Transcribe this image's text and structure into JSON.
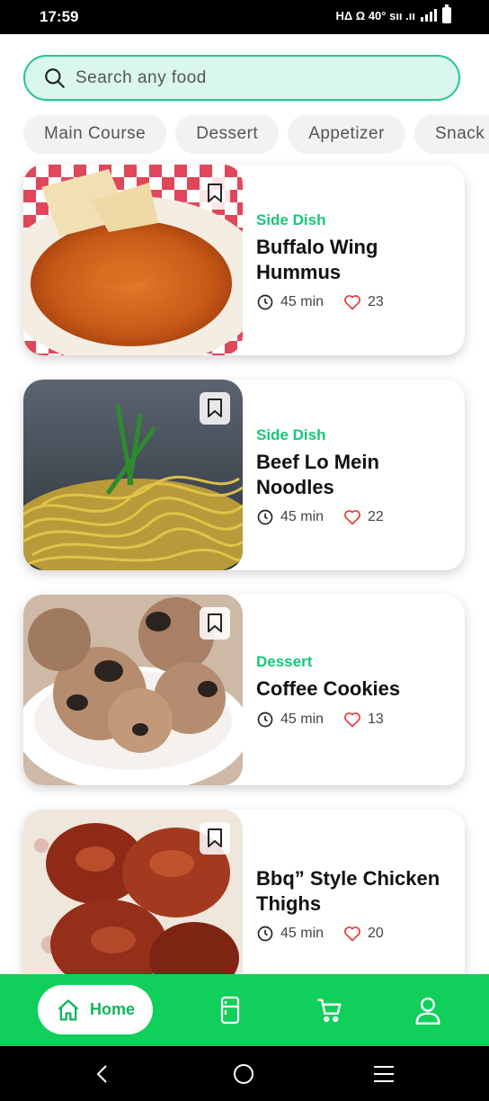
{
  "status_bar": {
    "time": "17:59",
    "indicators": "ΗΔ Ω 40° ѕıı .ıı"
  },
  "search": {
    "placeholder": "Search any food",
    "icon": "search-icon"
  },
  "categories": [
    "Main Course",
    "Dessert",
    "Appetizer",
    "Snack"
  ],
  "recipes": [
    {
      "category": "Side Dish",
      "title": "Buffalo Wing Hummus",
      "time": "45 min",
      "likes": "23"
    },
    {
      "category": "Side Dish",
      "title": "Beef Lo Mein Noodles",
      "time": "45 min",
      "likes": "22"
    },
    {
      "category": "Dessert",
      "title": "Coffee Cookies",
      "time": "45 min",
      "likes": "13"
    },
    {
      "category": "",
      "title": "Bbq” Style Chicken Thighs",
      "time": "45 min",
      "likes": "20"
    }
  ],
  "bottom_nav": {
    "home_label": "Home",
    "items": [
      "home-icon",
      "fridge-icon",
      "cart-icon",
      "profile-icon"
    ]
  },
  "colors": {
    "accent": "#10cf5a",
    "category_green": "#16c77a",
    "search_bg": "#d9f7ee",
    "heart_red": "#e53935"
  }
}
